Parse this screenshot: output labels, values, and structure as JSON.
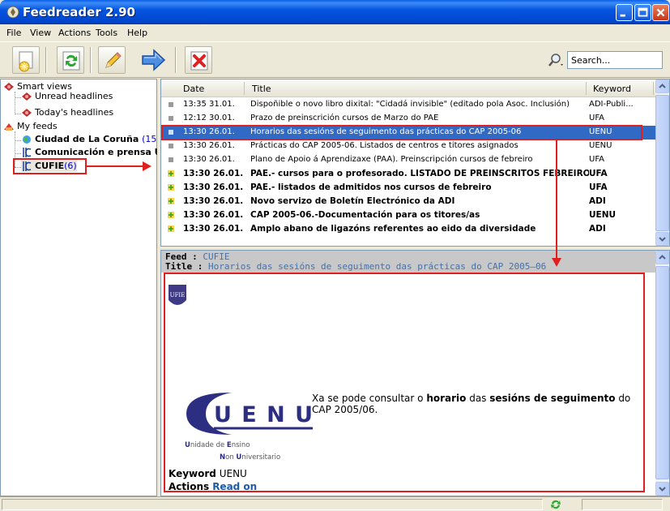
{
  "window": {
    "title": "Feedreader 2.90"
  },
  "menu": [
    "File",
    "View",
    "Actions",
    "Tools",
    "Help"
  ],
  "toolbar": {
    "buttons": [
      "new-feed",
      "refresh",
      "edit",
      "forward",
      "delete"
    ],
    "search_placeholder": "Search..."
  },
  "tree": {
    "smart_views": "Smart views",
    "unread": "Unread headlines",
    "today": "Today's headlines",
    "my_feeds": "My feeds",
    "feed1": {
      "name": "Ciudad de La Coruña",
      "count": "(15)"
    },
    "feed2": {
      "name": "Comunicación e prensa U"
    },
    "feed3": {
      "name": "CUFIE",
      "count": "(6)"
    }
  },
  "list": {
    "headers": {
      "date": "Date",
      "title": "Title",
      "keyword": "Keyword"
    },
    "rows": [
      {
        "date": "13:35 31.01.",
        "title": "Dispoñible o novo libro dixital: \"Cidadá invisible\" (editado pola Asoc. Inclusión)",
        "keyword": "ADI-Publi...",
        "bold": false,
        "selected": false
      },
      {
        "date": "12:12 30.01.",
        "title": "Prazo de preinscrición cursos de Marzo do PAE",
        "keyword": "UFA",
        "bold": false,
        "selected": false
      },
      {
        "date": "13:30 26.01.",
        "title": "Horarios das sesións de seguimento das prácticas do CAP 2005-06",
        "keyword": "UENU",
        "bold": false,
        "selected": true
      },
      {
        "date": "13:30 26.01.",
        "title": "Prácticas do CAP 2005-06. Listados de centros e titores asignados",
        "keyword": "UENU",
        "bold": false,
        "selected": false
      },
      {
        "date": "13:30 26.01.",
        "title": "Plano de Apoio á Aprendizaxe (PAA). Preinscripción cursos de febreiro",
        "keyword": "UFA",
        "bold": false,
        "selected": false
      },
      {
        "date": "13:30 26.01.",
        "title": "PAE.- cursos para o profesorado. LISTADO DE PREINSCRITOS FEBREIRO",
        "keyword": "UFA",
        "bold": true,
        "selected": false
      },
      {
        "date": "13:30 26.01.",
        "title": "PAE.- listados de admitidos nos cursos de febreiro",
        "keyword": "UFA",
        "bold": true,
        "selected": false
      },
      {
        "date": "13:30 26.01.",
        "title": "Novo servizo de Boletín Electrónico da ADI",
        "keyword": "ADI",
        "bold": true,
        "selected": false
      },
      {
        "date": "13:30 26.01.",
        "title": "CAP 2005-06.-Documentación para os titores/as",
        "keyword": "UENU",
        "bold": true,
        "selected": false
      },
      {
        "date": "13:30 26.01.",
        "title": "Amplo abano de ligazóns referentes ao eido da diversidade",
        "keyword": "ADI",
        "bold": true,
        "selected": false
      }
    ]
  },
  "preview": {
    "feed_label": "Feed :",
    "feed_value": "CUFIE",
    "title_label": "Title :",
    "title_value": "Horarios das sesións de seguimento das prácticas do CAP 2005–06",
    "badge_text": "UFIE",
    "logo_text": "UENU",
    "logo_line1_a": "U",
    "logo_line1_b": "nidade de ",
    "logo_line1_c": "E",
    "logo_line1_d": "nsino",
    "logo_line2_a": "N",
    "logo_line2_b": "on ",
    "logo_line2_c": "U",
    "logo_line2_d": "niversitario",
    "body_1": "Xa se pode consultar o ",
    "body_bold1": "horario",
    "body_2": " das ",
    "body_bold2": "sesións de seguimento",
    "body_3": " do CAP 2005/06.",
    "keyword_label": "Keyword",
    "keyword_value": "UENU",
    "actions_label": "Actions",
    "read_on": "Read on"
  },
  "colors": {
    "accent": "#316ac5",
    "annotation": "#e0201f",
    "link": "#1e5aa8"
  }
}
